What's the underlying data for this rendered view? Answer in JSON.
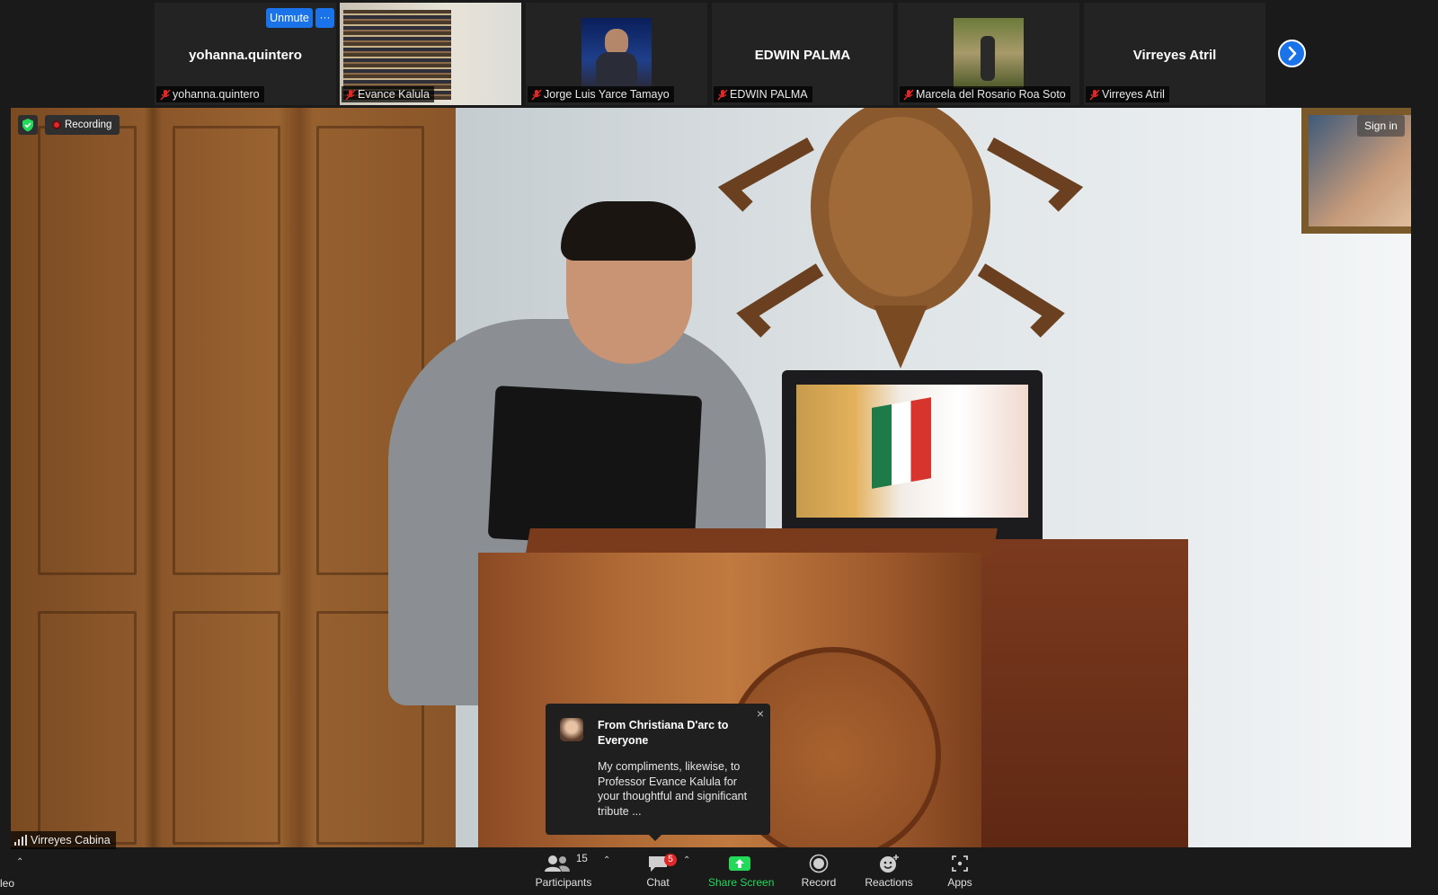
{
  "filmstrip": {
    "tiles": [
      {
        "name": "yohanna.quintero",
        "label": "yohanna.quintero",
        "has_video": false
      },
      {
        "name": "",
        "label": "Evance Kalula",
        "has_video": true
      },
      {
        "name": "",
        "label": "Jorge Luis Yarce Tamayo",
        "has_video": true
      },
      {
        "name": "EDWIN PALMA",
        "label": "EDWIN PALMA",
        "has_video": false
      },
      {
        "name": "",
        "label": "Marcela del Rosario Roa Soto",
        "has_video": true
      },
      {
        "name": "Virreyes Atril",
        "label": "Virreyes Atril",
        "has_video": false
      }
    ],
    "unmute_label": "Unmute",
    "more_label": "···"
  },
  "main": {
    "recording_label": "Recording",
    "signin_label": "Sign in",
    "speaker_label": "Virreyes Cabina"
  },
  "chat_popup": {
    "from": "From Christiana D'arc to Everyone",
    "message": "My compliments, likewise, to Professor Evance Kalula for your thoughtful and significant tribute ...",
    "close": "×"
  },
  "toolbar": {
    "cut_left": "leo",
    "participants": {
      "label": "Participants",
      "count": "15"
    },
    "chat": {
      "label": "Chat",
      "badge": "5"
    },
    "share": {
      "label": "Share Screen"
    },
    "record": {
      "label": "Record"
    },
    "reactions": {
      "label": "Reactions"
    },
    "apps": {
      "label": "Apps"
    }
  },
  "colors": {
    "accent_blue": "#1a73e8",
    "share_green": "#23d959",
    "recording_red": "#e02828",
    "mic_off_red": "#e02828"
  }
}
